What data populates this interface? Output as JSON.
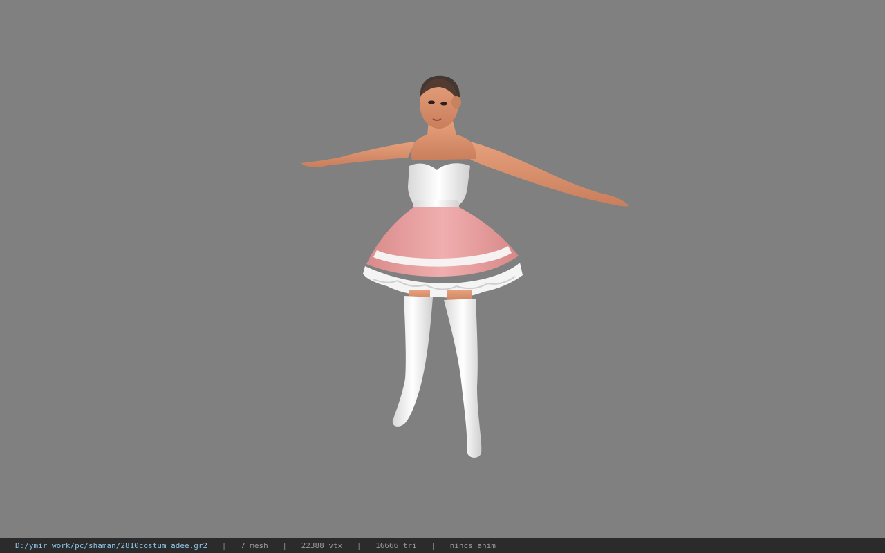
{
  "viewer": {
    "background_color": "#808080",
    "status_bar_color": "#2b2b2b",
    "path_color": "#8fc4e8"
  },
  "status": {
    "file_path": "D:/ymir work/pc/shaman/2810costum_adee.gr2",
    "separator": "|",
    "mesh": "7 mesh",
    "vertices": "22388 vtx",
    "triangles": "16666 tri",
    "anim": "nincs anim"
  },
  "model": {
    "skin_color": "#d9926e",
    "dress_pink": "#e8a09f",
    "dress_white": "#f2f2f2",
    "hair_color": "#3a2a24"
  }
}
